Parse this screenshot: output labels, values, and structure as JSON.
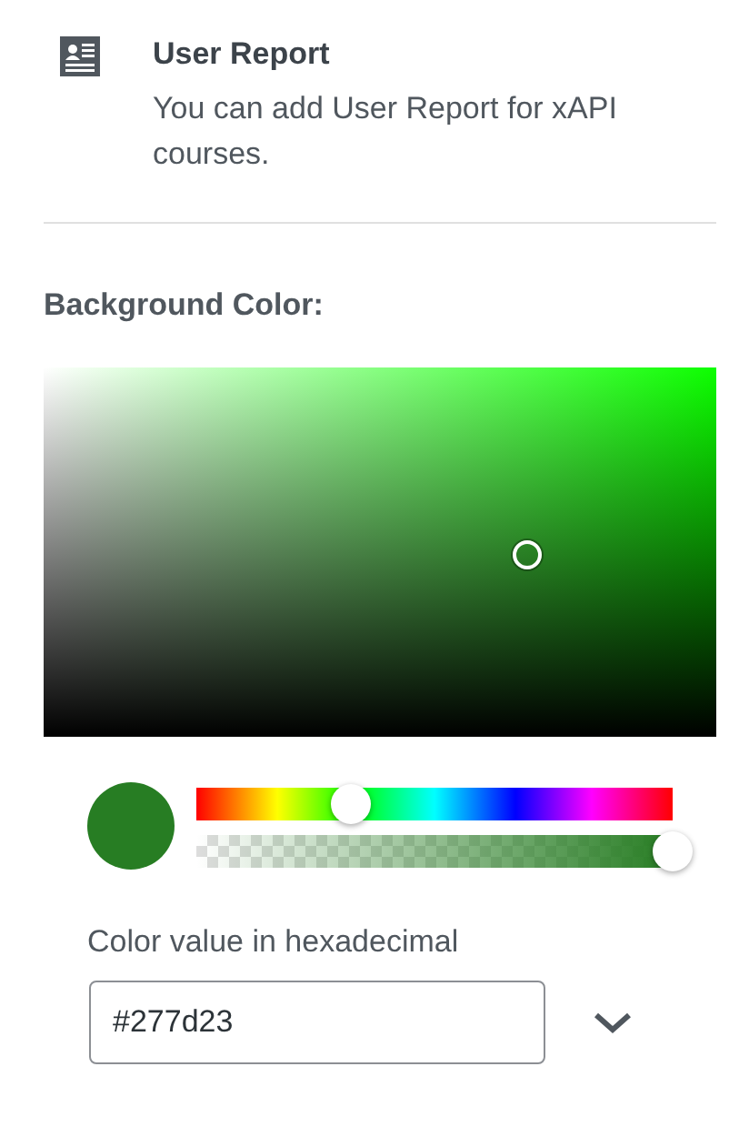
{
  "block": {
    "title": "User Report",
    "description": "You can add User Report for xAPI courses."
  },
  "color_setting": {
    "label": "Background Color:",
    "color": "#277d23",
    "hue": {
      "level": 0.325
    },
    "alpha": {
      "level": 1
    },
    "hex_label": "Color value in hexadecimal",
    "hex_value": "#277d23",
    "expanded": false
  }
}
